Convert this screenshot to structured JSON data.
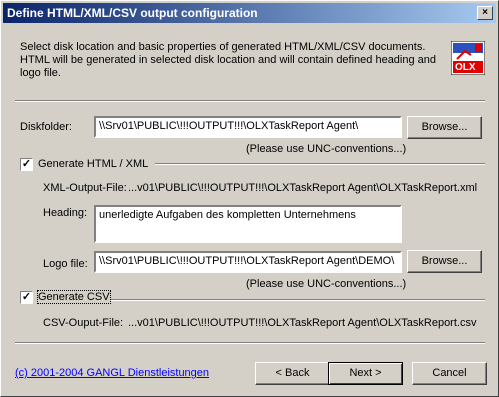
{
  "window": {
    "title": "Define HTML/XML/CSV output configuration",
    "close_glyph": "×"
  },
  "description": "Select disk location and basic properties of generated HTML/XML/CSV documents. HTML will be generated in selected disk location and will contain defined heading and logo file.",
  "logo": {
    "text": "OLX"
  },
  "diskfolder": {
    "label": "Diskfolder:",
    "value": "\\\\Srv01\\PUBLIC\\!!!OUTPUT!!!\\OLXTaskReport Agent\\",
    "browse": "Browse...",
    "hint": "(Please use UNC-conventions...)"
  },
  "html": {
    "checkbox_label": "Generate HTML / XML",
    "checked": true,
    "xml_label": "XML-Output-File:",
    "xml_value": "...v01\\PUBLIC\\!!!OUTPUT!!!\\OLXTaskReport Agent\\OLXTaskReport.xml",
    "heading_label": "Heading:",
    "heading_value": "unerledigte Aufgaben des kompletten Unternehmens",
    "logo_label": "Logo file:",
    "logo_value": "\\\\Srv01\\PUBLIC\\!!!OUTPUT!!!\\OLXTaskReport Agent\\DEMO\\",
    "browse": "Browse...",
    "hint": "(Please use UNC-conventions...)"
  },
  "csv": {
    "checkbox_label": "Generate CSV",
    "checked": true,
    "file_label": "CSV-Ouput-File:",
    "file_value": "...v01\\PUBLIC\\!!!OUTPUT!!!\\OLXTaskReport Agent\\OLXTaskReport.csv"
  },
  "footer": {
    "copyright": "(c) 2001-2004 GANGL Dienstleistungen",
    "back": "< Back",
    "next": "Next >",
    "cancel": "Cancel"
  }
}
